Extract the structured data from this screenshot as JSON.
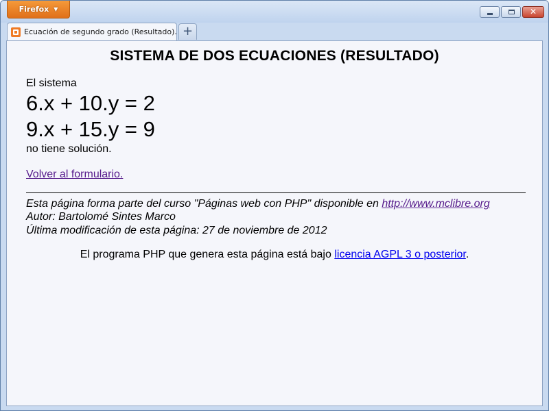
{
  "browser": {
    "firefox_label": "Firefox",
    "close_glyph": "✕",
    "tab": {
      "title": "Ecuación de segundo grado (Resultado)...."
    },
    "newtab_glyph": "+"
  },
  "page": {
    "title": "SISTEMA DE DOS ECUACIONES (RESULTADO)",
    "intro": "El sistema",
    "equations": [
      "6.x + 10.y = 2",
      "9.x + 15.y = 9"
    ],
    "result": "no tiene solución.",
    "back_link": "Volver al formulario.",
    "footer": {
      "course_prefix": "Esta página forma parte del curso \"Páginas web con PHP\" disponible en ",
      "course_link": "http://www.mclibre.org",
      "author": "Autor: Bartolomé Sintes Marco",
      "last_modified": "Última modificación de esta página: 27 de noviembre de 2012"
    },
    "license": {
      "prefix": "El programa PHP que genera esta página está bajo ",
      "link": "licencia AGPL 3 o posterior",
      "suffix": "."
    }
  },
  "colors": {
    "link": "#0000ee",
    "visited_link": "#551a8b",
    "firefox_button": "#e87e24",
    "page_background": "#f5f6fb"
  },
  "icons": {
    "favicon": "mclibre-favicon",
    "menu_caret": "caret-down-icon",
    "minimize": "minimize-icon",
    "maximize": "maximize-icon",
    "close": "close-icon",
    "new_tab": "plus-icon"
  }
}
